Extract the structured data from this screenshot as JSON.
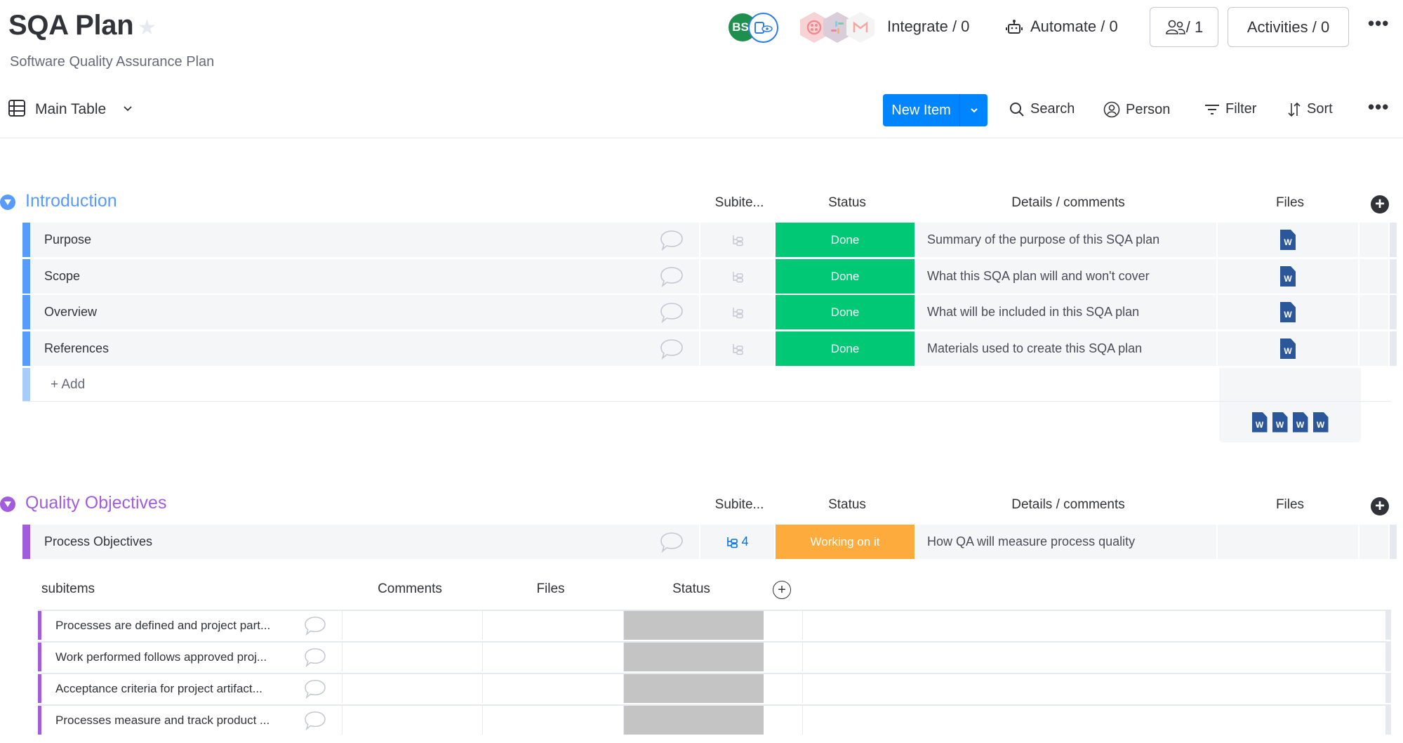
{
  "board": {
    "title": "SQA Plan",
    "subtitle": "Software Quality Assurance Plan",
    "avatar_initials": "BS",
    "integrate_label": "Integrate / 0",
    "automate_label": "Automate / 0",
    "members_label": "/ 1",
    "activities_label": "Activities / 0"
  },
  "toolbar": {
    "view_label": "Main Table",
    "new_item_label": "New Item",
    "search_label": "Search",
    "person_label": "Person",
    "filter_label": "Filter",
    "sort_label": "Sort"
  },
  "groups": [
    {
      "title": "Introduction",
      "color": "#579bfc",
      "columns": {
        "subitems": "Subite...",
        "status": "Status",
        "details": "Details / comments",
        "files": "Files"
      },
      "rows": [
        {
          "name": "Purpose",
          "status": "Done",
          "status_color": "#00c875",
          "details": "Summary of the purpose of this SQA plan",
          "file": "W"
        },
        {
          "name": "Scope",
          "status": "Done",
          "status_color": "#00c875",
          "details": "What this SQA plan will and won't cover",
          "file": "W"
        },
        {
          "name": "Overview",
          "status": "Done",
          "status_color": "#00c875",
          "details": "What will be included in this SQA plan",
          "file": "W"
        },
        {
          "name": "References",
          "status": "Done",
          "status_color": "#00c875",
          "details": "Materials used to create this SQA plan",
          "file": "W"
        }
      ],
      "add_label": "+ Add",
      "summary_files": [
        "W",
        "W",
        "W",
        "W"
      ]
    },
    {
      "title": "Quality Objectives",
      "color": "#a25ddc",
      "columns": {
        "subitems": "Subite...",
        "status": "Status",
        "details": "Details / comments",
        "files": "Files"
      },
      "rows": [
        {
          "name": "Process Objectives",
          "subitem_count": "4",
          "status": "Working on it",
          "status_color": "#fdab3d",
          "details": "How QA will measure process quality"
        }
      ]
    }
  ],
  "subitems": {
    "columns": {
      "name": "subitems",
      "comments": "Comments",
      "files": "Files",
      "status": "Status"
    },
    "rows": [
      {
        "name": "Processes are defined and project part..."
      },
      {
        "name": "Work performed follows approved proj..."
      },
      {
        "name": "Acceptance criteria for project artifact..."
      },
      {
        "name": "Processes measure and track product ..."
      }
    ]
  }
}
